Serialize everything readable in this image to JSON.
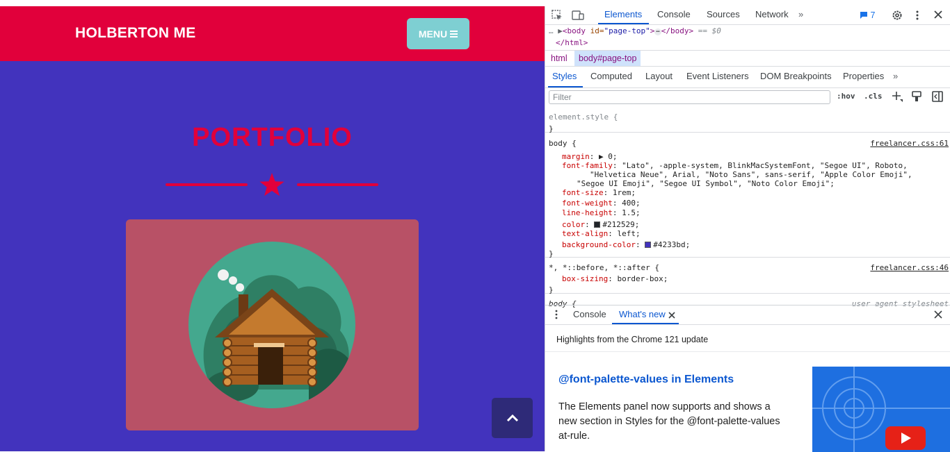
{
  "page": {
    "brand": "HOLBERTON ME",
    "menu_label": "MENU",
    "section_title": "PORTFOLIO",
    "colors": {
      "primary": "#e1003b",
      "background": "#4233bd",
      "menu_button": "#7ecfd2",
      "card": "#b85166",
      "scroll_button": "#2e2a78"
    },
    "icons": {
      "menu": "hamburger-icon",
      "divider": "star-icon",
      "scroll_top": "chevron-up-icon",
      "card": "log-cabin-illustration"
    }
  },
  "devtools": {
    "tabs": [
      "Elements",
      "Console",
      "Sources",
      "Network"
    ],
    "active_tab": "Elements",
    "issues_count": "7",
    "dom": {
      "line1_tag_open": "<body",
      "line1_attr_name": " id=",
      "line1_attr_val": "\"page-top\"",
      "line1_tag_mid": ">",
      "line1_ellipsis": "⋯",
      "line1_tag_close": "</body>",
      "line1_suffix": " == $0",
      "line2": "</html>"
    },
    "breadcrumbs": [
      "html",
      "body#page-top"
    ],
    "subtabs": [
      "Styles",
      "Computed",
      "Layout",
      "Event Listeners",
      "DOM Breakpoints",
      "Properties"
    ],
    "filter_placeholder": "Filter",
    "filter_tools": [
      ":hov",
      ".cls"
    ],
    "rules": {
      "element_style": {
        "selector": "element.style {",
        "close": "}"
      },
      "body_rule": {
        "selector": "body {",
        "source": "freelancer.css:61",
        "props": [
          {
            "name": "margin",
            "value": "▶ 0;"
          },
          {
            "name": "font-family",
            "value": "\"Lato\", -apple-system, BlinkMacSystemFont, \"Segoe UI\", Roboto,"
          },
          {
            "name": "",
            "value": "\"Helvetica Neue\", Arial, \"Noto Sans\", sans-serif, \"Apple Color Emoji\","
          },
          {
            "name": "",
            "value": "\"Segoe UI Emoji\", \"Segoe UI Symbol\", \"Noto Color Emoji\";"
          },
          {
            "name": "font-size",
            "value": "1rem;"
          },
          {
            "name": "font-weight",
            "value": "400;"
          },
          {
            "name": "line-height",
            "value": "1.5;"
          },
          {
            "name": "color",
            "value": "#212529;"
          },
          {
            "name": "text-align",
            "value": "left;"
          },
          {
            "name": "background-color",
            "value": "#4233bd;"
          }
        ],
        "close": "}"
      },
      "universal_rule": {
        "selector": "*, *::before, *::after {",
        "source": "freelancer.css:46",
        "props": [
          {
            "name": "box-sizing",
            "value": "border-box;"
          }
        ],
        "close": "}"
      },
      "ua_rule": {
        "selector": "body {",
        "source": "user agent stylesheet"
      }
    },
    "drawer": {
      "tabs": [
        "Console",
        "What's new"
      ],
      "active_tab": "What's new",
      "highlight": "Highlights from the Chrome 121 update",
      "heading": "@font-palette-values in Elements",
      "body": "The Elements panel now supports and shows a new section in Styles for the @font-palette-values at-rule."
    }
  }
}
